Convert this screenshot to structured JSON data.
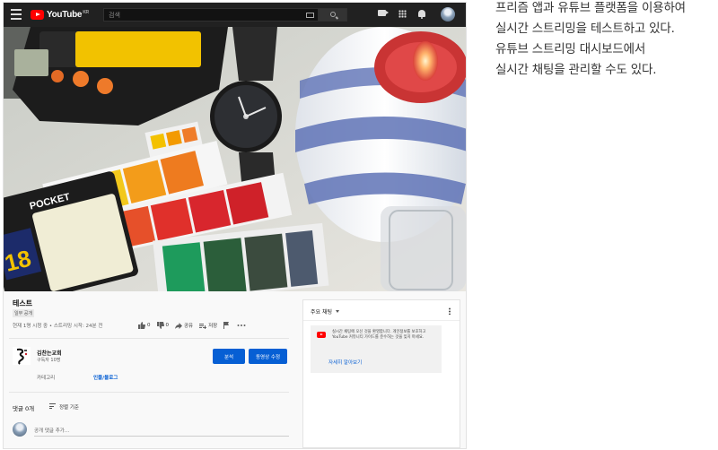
{
  "topbar": {
    "logo_text": "YouTube",
    "logo_sup": "KR",
    "search_placeholder": "검색"
  },
  "video": {
    "title": "테스트",
    "visibility_badge": "일부 공개",
    "views_text": "현재 1명 시청 중 • 스트리밍 시작: 24분 전",
    "likes": "0",
    "dislikes": "0",
    "share_label": "공유",
    "save_label": "저장"
  },
  "channel": {
    "name": "김찬는교회",
    "subscribers": "구독자 10명",
    "analytics_button": "분석",
    "edit_button": "동영상 수정",
    "category_label": "카테고리",
    "category_value": "인물/블로그"
  },
  "comments": {
    "count_label": "댓글 0개",
    "sort_label": "정렬 기준",
    "input_placeholder": "공개 댓글 추가..."
  },
  "chat": {
    "header": "주요 채팅",
    "notice": "실시간 채팅에 오신 것을 환영합니다. 개인정보를 보호하고 YouTube 커뮤니티 가이드를 준수하는 것을 잊지 마세요.",
    "learn_more": "자세히 알아보기"
  },
  "caption": {
    "lines": [
      "프리즘 앱과 유튜브 플랫폼을 이용하여",
      "실시간 스트리밍을 테스트하고 있다.",
      "유튜브 스트리밍 대시보드에서",
      "실시간 채팅을 관리할 수도 있다."
    ]
  },
  "colors": {
    "accent": "#065fd4",
    "brand": "#ff0000",
    "topbar": "#212121"
  }
}
